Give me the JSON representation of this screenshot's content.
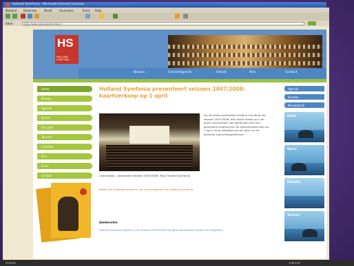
{
  "browser": {
    "title": "Holland Symfonia - Microsoft Internet Explorer",
    "menu": [
      "Bestand",
      "Bewerken",
      "Beeld",
      "Favorieten",
      "Extra",
      "Help"
    ],
    "address_label": "Adres",
    "address": "http://www.hollandsymfonia.nl/",
    "status_left": "Gereed",
    "status_right": "Internet"
  },
  "site": {
    "logo_mark": "HS",
    "logo_sub": "HOLLAND SYMFONIA",
    "top_nav": [
      "Nieuws",
      "Concertagenda",
      "Orkest",
      "Pers",
      "Contact"
    ],
    "left_nav": [
      "Home",
      "Nieuws",
      "Agenda",
      "Orkest",
      "Educatie",
      "Tournee",
      "Vrienden",
      "Pers",
      "Links",
      "Contact"
    ],
    "headline": "Holland Symfonia presenteert seizoen 2007/2008: kaartverkoop op 1 april",
    "body_text": "Op 26 maart presenteert Holland Symfonia het seizoen 2007/2008. Het orkest treedt op in de grote concertzalen van Nederland met een gevarieerd programma. De kaartverkoop start op 1 april via de websites van de zalen en de bekende voorverkoopadressen.",
    "caption": "Concertzaal - presentatie seizoen 2007/2008. Foto: Holland Symfonia",
    "note": "Bekijk het volledige seizoen in de concertagenda van Holland Symfonia.",
    "section_title": "Aanbevolen",
    "section_text": "Holland Symfonia speelt in het seizoen 2007/2008 met gerenommeerde solisten en dirigenten.",
    "right_buttons": [
      "Agenda",
      "Kaarten",
      "Nieuwsbrief"
    ],
    "tiles": [
      "Ballet",
      "Opera",
      "Educatie",
      "Tournee"
    ]
  }
}
